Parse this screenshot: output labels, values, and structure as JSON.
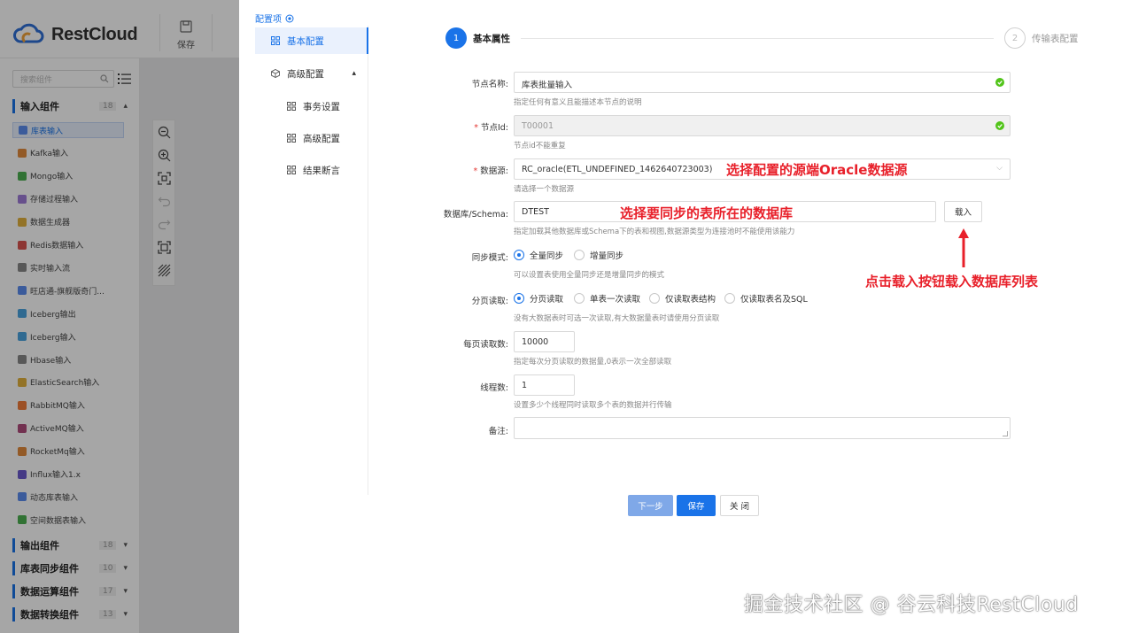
{
  "app": {
    "brand": "RestCloud",
    "toolbar_save": "保存"
  },
  "sidebar": {
    "search_placeholder": "搜索组件",
    "input_group": {
      "label": "输入组件",
      "count": "18"
    },
    "items": [
      {
        "label": "库表输入",
        "color": "#5b8def"
      },
      {
        "label": "Kafka输入",
        "color": "#e28b3c"
      },
      {
        "label": "Mongo输入",
        "color": "#4caf50"
      },
      {
        "label": "存储过程输入",
        "color": "#9e7bd8"
      },
      {
        "label": "数据生成器",
        "color": "#e2b13c"
      },
      {
        "label": "Redis数据输入",
        "color": "#d9534f"
      },
      {
        "label": "实时输入流",
        "color": "#888888"
      },
      {
        "label": "旺店通-旗舰版奇门...",
        "color": "#5b8def"
      },
      {
        "label": "Iceberg输出",
        "color": "#4aa3df"
      },
      {
        "label": "Iceberg输入",
        "color": "#4aa3df"
      },
      {
        "label": "Hbase输入",
        "color": "#888888"
      },
      {
        "label": "ElasticSearch输入",
        "color": "#e2b13c"
      },
      {
        "label": "RabbitMQ输入",
        "color": "#f07b3a"
      },
      {
        "label": "ActiveMQ输入",
        "color": "#b04c7b"
      },
      {
        "label": "RocketMq输入",
        "color": "#e28b3c"
      },
      {
        "label": "Influx输入1.x",
        "color": "#6a5acd"
      },
      {
        "label": "动态库表输入",
        "color": "#5b8def"
      },
      {
        "label": "空间数据表输入",
        "color": "#4caf50"
      }
    ],
    "groups_bottom": [
      {
        "label": "输出组件",
        "count": "18"
      },
      {
        "label": "库表同步组件",
        "count": "10"
      },
      {
        "label": "数据运算组件",
        "count": "17"
      },
      {
        "label": "数据转换组件",
        "count": "13"
      }
    ]
  },
  "config_menu": {
    "title": "配置项",
    "items": [
      {
        "label": "基本配置"
      },
      {
        "label": "高级配置"
      },
      {
        "label": "事务设置"
      },
      {
        "label": "高级配置"
      },
      {
        "label": "结果断言"
      }
    ]
  },
  "steps": {
    "step1_num": "1",
    "step1_label": "基本属性",
    "step2_num": "2",
    "step2_label": "传输表配置"
  },
  "form": {
    "node_name": {
      "label": "节点名称:",
      "value": "库表批量输入",
      "hint": "指定任何有意义且能描述本节点的说明"
    },
    "node_id": {
      "label": "节点Id:",
      "value": "T00001",
      "hint": "节点id不能重复"
    },
    "datasource": {
      "label": "数据源:",
      "value": "RC_oracle(ETL_UNDEFINED_1462640723003)",
      "hint": "请选择一个数据源"
    },
    "schema": {
      "label": "数据库/Schema:",
      "value": "DTEST",
      "load_button": "载入",
      "hint": "指定加载其他数据库或Schema下的表和视图,数据源类型为连接池时不能使用该能力"
    },
    "sync_mode": {
      "label": "同步模式:",
      "options": [
        "全量同步",
        "增量同步"
      ],
      "selected": 0,
      "hint": "可以设置表使用全量同步还是增量同步的模式"
    },
    "paging": {
      "label": "分页读取:",
      "options": [
        "分页读取",
        "单表一次读取",
        "仅读取表结构",
        "仅读取表名及SQL"
      ],
      "selected": 0,
      "hint": "没有大数据表时可选一次读取,有大数据量表时请使用分页读取"
    },
    "page_size": {
      "label": "每页读取数:",
      "value": "10000",
      "hint": "指定每次分页读取的数据量,0表示一次全部读取"
    },
    "threads": {
      "label": "线程数:",
      "value": "1",
      "hint": "设置多少个线程同时读取多个表的数据并行传输"
    },
    "remark": {
      "label": "备注:",
      "value": ""
    }
  },
  "buttons": {
    "next": "下一步",
    "save": "保存",
    "close": "关 闭"
  },
  "annotations": {
    "a1": "选择配置的源端Oracle数据源",
    "a2": "选择要同步的表所在的数据库",
    "a3": "点击载入按钮载入数据库列表",
    "color": "#e8202a"
  },
  "watermark": "掘金技术社区 @ 谷云科技RestCloud"
}
